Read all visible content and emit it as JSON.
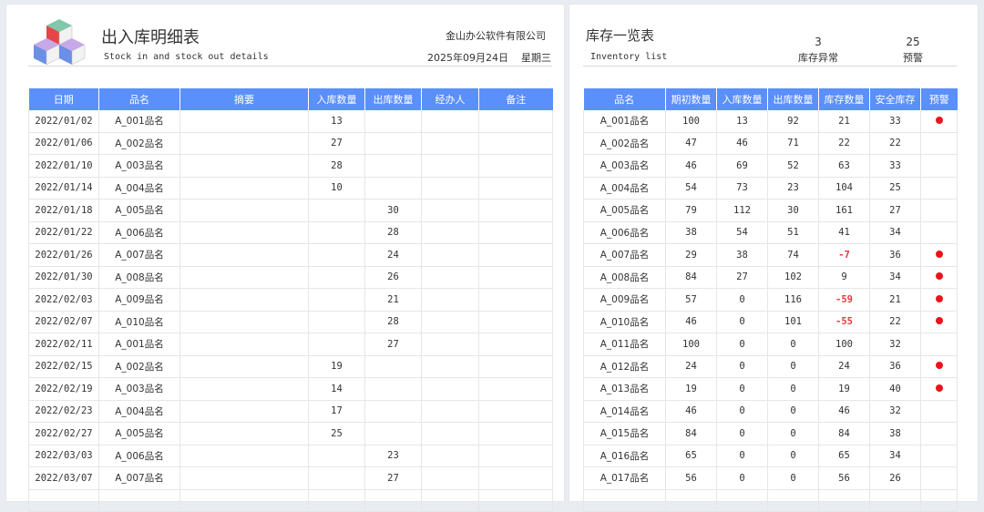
{
  "left": {
    "title": "出入库明细表",
    "subtitle": "Stock in and stock out details",
    "company": "金山办公软件有限公司",
    "date": "2025年09月24日",
    "weekday": "星期三",
    "columns": [
      "日期",
      "品名",
      "摘要",
      "入库数量",
      "出库数量",
      "经办人",
      "备注"
    ],
    "rows": [
      [
        "2022/01/02",
        "A_001品名",
        "",
        "13",
        "",
        "",
        ""
      ],
      [
        "2022/01/06",
        "A_002品名",
        "",
        "27",
        "",
        "",
        ""
      ],
      [
        "2022/01/10",
        "A_003品名",
        "",
        "28",
        "",
        "",
        ""
      ],
      [
        "2022/01/14",
        "A_004品名",
        "",
        "10",
        "",
        "",
        ""
      ],
      [
        "2022/01/18",
        "A_005品名",
        "",
        "",
        "30",
        "",
        ""
      ],
      [
        "2022/01/22",
        "A_006品名",
        "",
        "",
        "28",
        "",
        ""
      ],
      [
        "2022/01/26",
        "A_007品名",
        "",
        "",
        "24",
        "",
        ""
      ],
      [
        "2022/01/30",
        "A_008品名",
        "",
        "",
        "26",
        "",
        ""
      ],
      [
        "2022/02/03",
        "A_009品名",
        "",
        "",
        "21",
        "",
        ""
      ],
      [
        "2022/02/07",
        "A_010品名",
        "",
        "",
        "28",
        "",
        ""
      ],
      [
        "2022/02/11",
        "A_001品名",
        "",
        "",
        "27",
        "",
        ""
      ],
      [
        "2022/02/15",
        "A_002品名",
        "",
        "19",
        "",
        "",
        ""
      ],
      [
        "2022/02/19",
        "A_003品名",
        "",
        "14",
        "",
        "",
        ""
      ],
      [
        "2022/02/23",
        "A_004品名",
        "",
        "17",
        "",
        "",
        ""
      ],
      [
        "2022/02/27",
        "A_005品名",
        "",
        "25",
        "",
        "",
        ""
      ],
      [
        "2022/03/03",
        "A_006品名",
        "",
        "",
        "23",
        "",
        ""
      ],
      [
        "2022/03/07",
        "A_007品名",
        "",
        "",
        "27",
        "",
        ""
      ],
      [
        "",
        "",
        "",
        "",
        "",
        "",
        ""
      ]
    ]
  },
  "right": {
    "title": "库存一览表",
    "subtitle": "Inventory list",
    "stat_abnormal_value": "3",
    "stat_abnormal_label": "库存异常",
    "stat_warning_value": "25",
    "stat_warning_label": "预警",
    "columns": [
      "品名",
      "期初数量",
      "入库数量",
      "出库数量",
      "库存数量",
      "安全库存",
      "预警"
    ],
    "rows": [
      {
        "cells": [
          "A_001品名",
          "100",
          "13",
          "92",
          "21",
          "33"
        ],
        "warn": true,
        "neg": false
      },
      {
        "cells": [
          "A_002品名",
          "47",
          "46",
          "71",
          "22",
          "22"
        ],
        "warn": false,
        "neg": false
      },
      {
        "cells": [
          "A_003品名",
          "46",
          "69",
          "52",
          "63",
          "33"
        ],
        "warn": false,
        "neg": false
      },
      {
        "cells": [
          "A_004品名",
          "54",
          "73",
          "23",
          "104",
          "25"
        ],
        "warn": false,
        "neg": false
      },
      {
        "cells": [
          "A_005品名",
          "79",
          "112",
          "30",
          "161",
          "27"
        ],
        "warn": false,
        "neg": false
      },
      {
        "cells": [
          "A_006品名",
          "38",
          "54",
          "51",
          "41",
          "34"
        ],
        "warn": false,
        "neg": false
      },
      {
        "cells": [
          "A_007品名",
          "29",
          "38",
          "74",
          "-7",
          "36"
        ],
        "warn": true,
        "neg": true
      },
      {
        "cells": [
          "A_008品名",
          "84",
          "27",
          "102",
          "9",
          "34"
        ],
        "warn": true,
        "neg": false
      },
      {
        "cells": [
          "A_009品名",
          "57",
          "0",
          "116",
          "-59",
          "21"
        ],
        "warn": true,
        "neg": true
      },
      {
        "cells": [
          "A_010品名",
          "46",
          "0",
          "101",
          "-55",
          "22"
        ],
        "warn": true,
        "neg": true
      },
      {
        "cells": [
          "A_011品名",
          "100",
          "0",
          "0",
          "100",
          "32"
        ],
        "warn": false,
        "neg": false
      },
      {
        "cells": [
          "A_012品名",
          "24",
          "0",
          "0",
          "24",
          "36"
        ],
        "warn": true,
        "neg": false
      },
      {
        "cells": [
          "A_013品名",
          "19",
          "0",
          "0",
          "19",
          "40"
        ],
        "warn": true,
        "neg": false
      },
      {
        "cells": [
          "A_014品名",
          "46",
          "0",
          "0",
          "46",
          "32"
        ],
        "warn": false,
        "neg": false
      },
      {
        "cells": [
          "A_015品名",
          "84",
          "0",
          "0",
          "84",
          "38"
        ],
        "warn": false,
        "neg": false
      },
      {
        "cells": [
          "A_016品名",
          "65",
          "0",
          "0",
          "65",
          "34"
        ],
        "warn": false,
        "neg": false
      },
      {
        "cells": [
          "A_017品名",
          "56",
          "0",
          "0",
          "56",
          "26"
        ],
        "warn": false,
        "neg": false
      },
      {
        "cells": [
          "",
          "",
          "",
          "",
          "",
          ""
        ],
        "warn": false,
        "neg": false
      }
    ]
  },
  "colors": {
    "header_bg": "#5b8ff9",
    "negative": "#e8383d",
    "warning_dot": "#e8151b"
  },
  "icons": {
    "logo": "stacked-cubes-logo-icon",
    "warning": "red-dot-icon"
  }
}
